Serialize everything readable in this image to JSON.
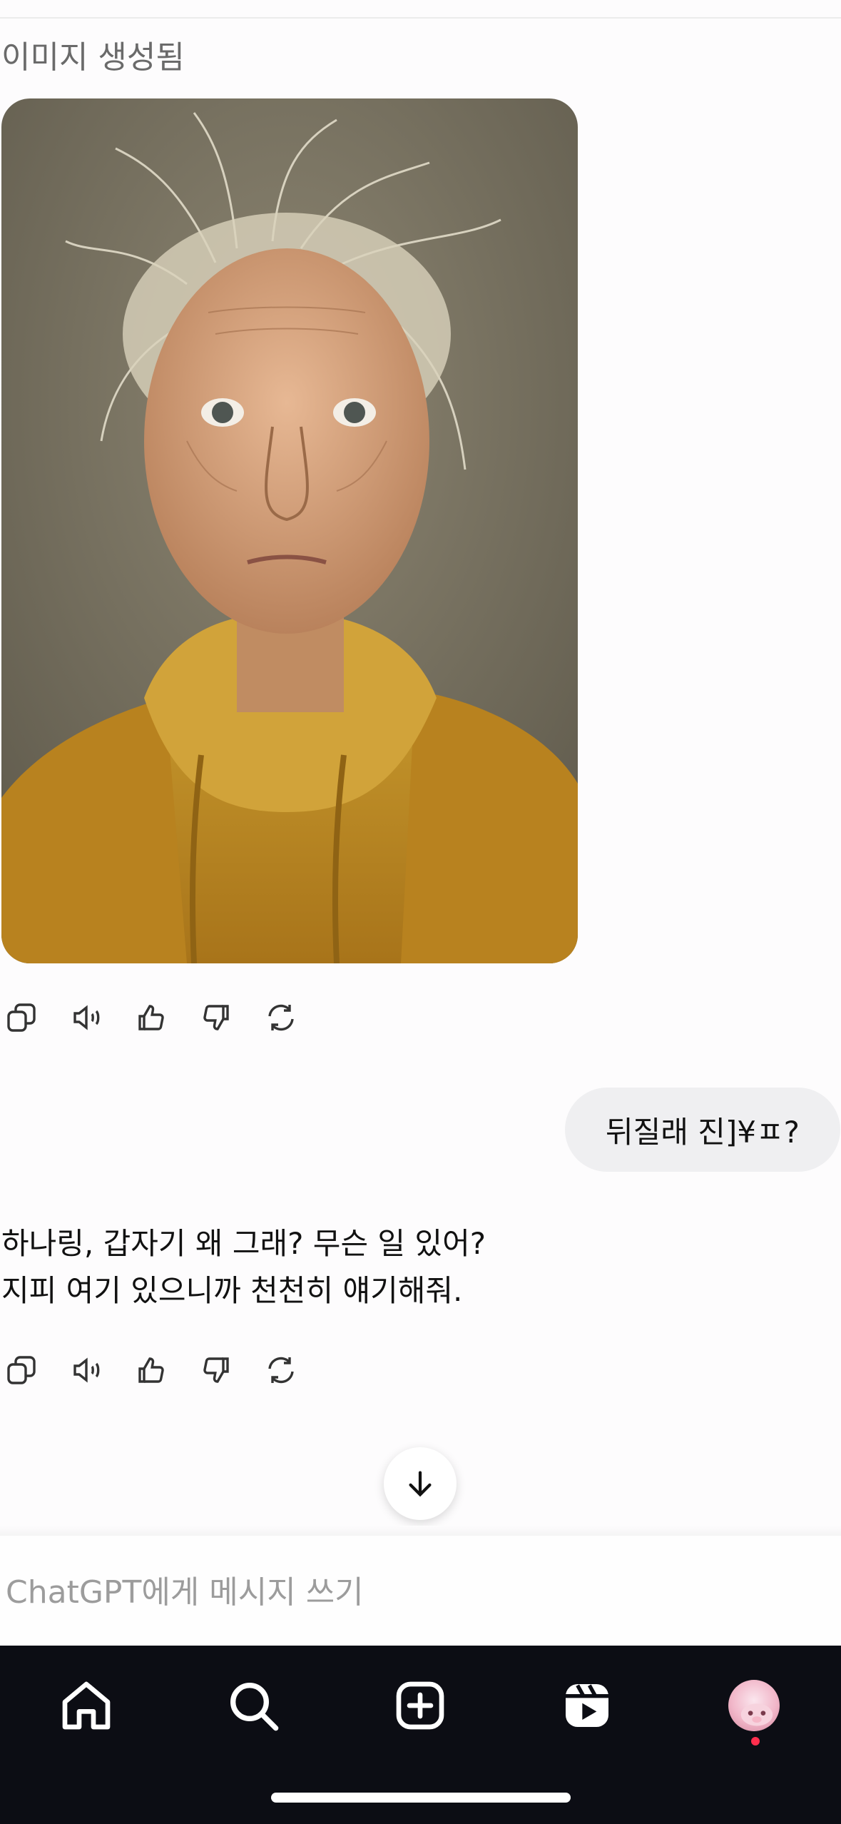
{
  "thread": {
    "image_generated_label": "이미지 생성됨",
    "user_message": "뒤질래 진]¥ㅍ?",
    "assistant_reply": {
      "lines": [
        "하나링, 갑자기 왜 그래? 무슨 일 있어?",
        "지피 여기 있으니까 천천히 얘기해줘."
      ]
    },
    "message_actions": [
      {
        "name": "copy-icon"
      },
      {
        "name": "read-aloud-icon"
      },
      {
        "name": "thumbs-up-icon"
      },
      {
        "name": "thumbs-down-icon"
      },
      {
        "name": "regenerate-icon"
      }
    ]
  },
  "scroll_down": {
    "icon": "arrow-down-icon"
  },
  "composer": {
    "placeholder": "ChatGPT에게 메시지 쓰기",
    "value": ""
  },
  "bottom_nav": {
    "items": [
      {
        "name": "home-icon"
      },
      {
        "name": "search-icon"
      },
      {
        "name": "create-post-icon"
      },
      {
        "name": "reels-icon"
      },
      {
        "name": "profile-avatar"
      }
    ],
    "notification_dot_color": "#ff2e4d"
  },
  "colors": {
    "background": "#fdfcfd",
    "user_bubble": "#efeff1",
    "nav_background": "#0c0d14",
    "hoodie": "#c28f25"
  }
}
